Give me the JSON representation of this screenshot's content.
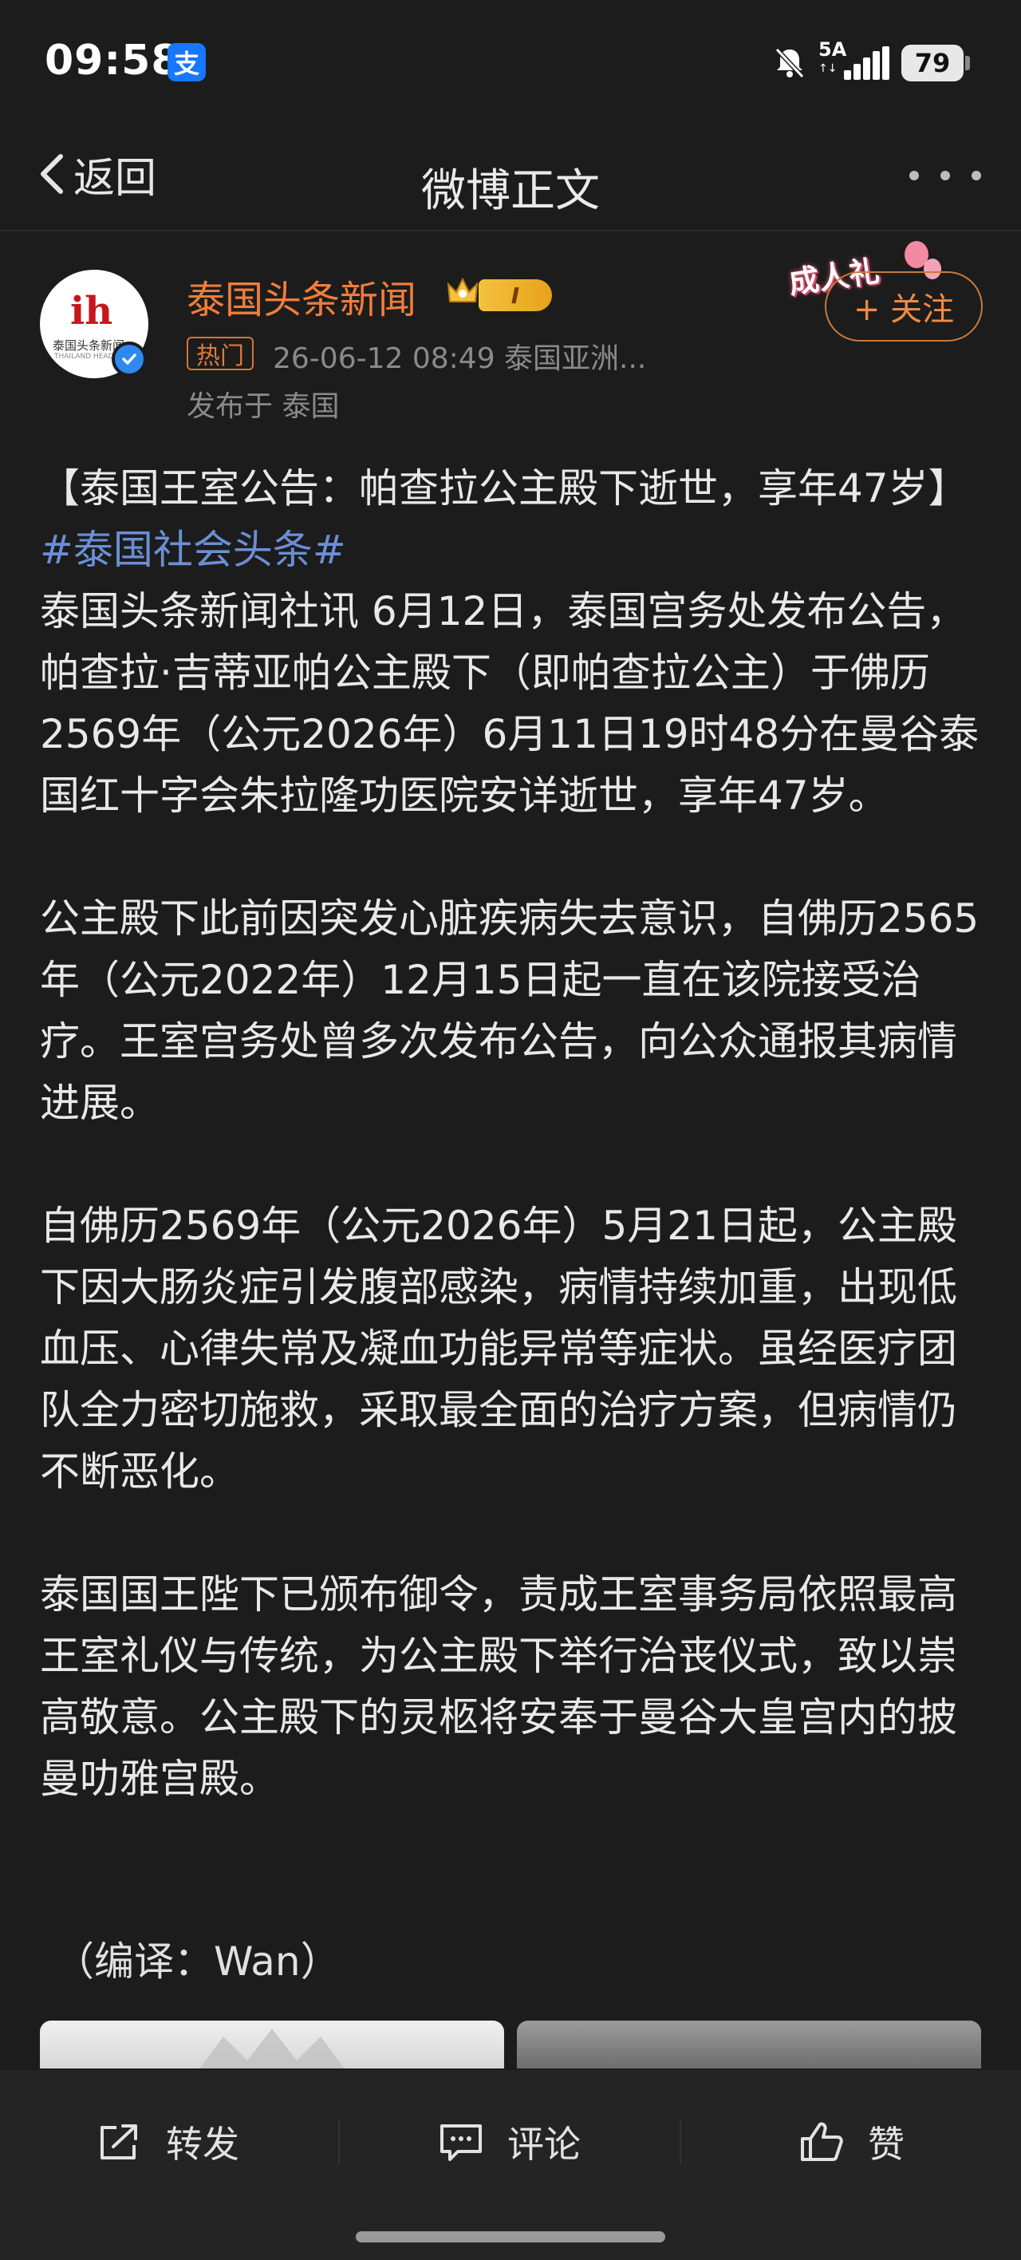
{
  "status_bar": {
    "time": "09:58",
    "app_badge": "支",
    "network": "5A",
    "battery": "79",
    "icons": [
      "alipay-icon",
      "mute-icon",
      "signal-icon",
      "battery-icon"
    ]
  },
  "nav": {
    "back_label": "返回",
    "title": "微博正文",
    "more_icon": "more-icon"
  },
  "author": {
    "avatar_logo": "ih",
    "avatar_cn": "泰国头条新闻",
    "avatar_en": "THAILAND HEADLINES",
    "name": "泰国头条新闻",
    "level": "I",
    "hot_badge": "热门",
    "meta": "26-06-12 08:49  泰国亚洲...",
    "publish_location": "发布于 泰国",
    "follow_label": "+ 关注",
    "gift_text": "成人礼",
    "colors": {
      "name": "#f07d3b",
      "verified": "#2d89ef",
      "hashtag": "#6b8fd6"
    }
  },
  "post": {
    "p1_text": "【泰国王室公告：帕查拉公主殿下逝世，享年47岁】",
    "p1_hashtag": "#泰国社会头条#",
    "p1_body": "泰国头条新闻社讯 6月12日，泰国宫务处发布公告，帕查拉·吉蒂亚帕公主殿下（即帕查拉公主）于佛历2569年（公元2026年）6月11日19时48分在曼谷泰国红十字会朱拉隆功医院安详逝世，享年47岁。",
    "p2": "公主殿下此前因突发心脏疾病失去意识，自佛历2565年（公元2022年）12月15日起一直在该院接受治疗。王室宫务处曾多次发布公告，向公众通报其病情进展。",
    "p3": "自佛历2569年（公元2026年）5月21日起，公主殿下因大肠炎症引发腹部感染，病情持续加重，出现低血压、心律失常及凝血功能异常等症状。虽经医疗团队全力密切施救，采取最全面的治疗方案，但病情仍不断恶化。",
    "p4": "泰国国王陛下已颁布御令，责成王室事务局依照最高王室礼仪与传统，为公主殿下举行治丧仪式，致以崇高敬意。公主殿下的灵柩将安奉于曼谷大皇宫内的披曼叻雅宫殿。",
    "compile": "（编译：Wan）"
  },
  "actions": {
    "share": "转发",
    "comment": "评论",
    "like": "赞"
  }
}
